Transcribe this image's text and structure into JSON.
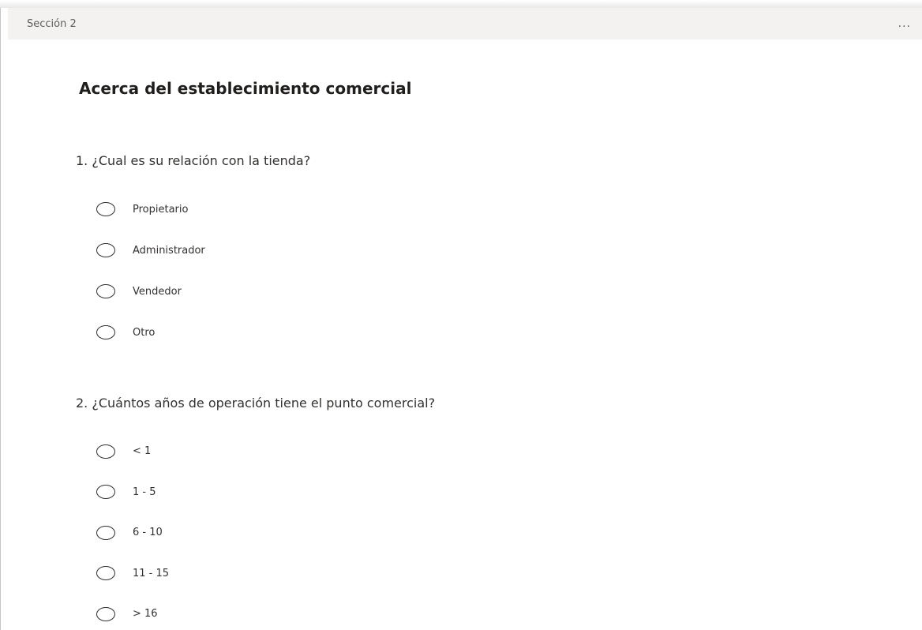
{
  "section": {
    "label": "Sección 2",
    "more_icon": "..."
  },
  "form": {
    "title": "Acerca del establecimiento comercial"
  },
  "questions": [
    {
      "text": "1. ¿Cual es su relación con la tienda?",
      "options": [
        "Propietario",
        "Administrador",
        "Vendedor",
        "Otro"
      ]
    },
    {
      "text": "2. ¿Cuántos años de operación tiene el punto comercial?",
      "options": [
        "< 1",
        "1 - 5",
        "6 - 10",
        "11 - 15",
        "> 16"
      ]
    }
  ]
}
